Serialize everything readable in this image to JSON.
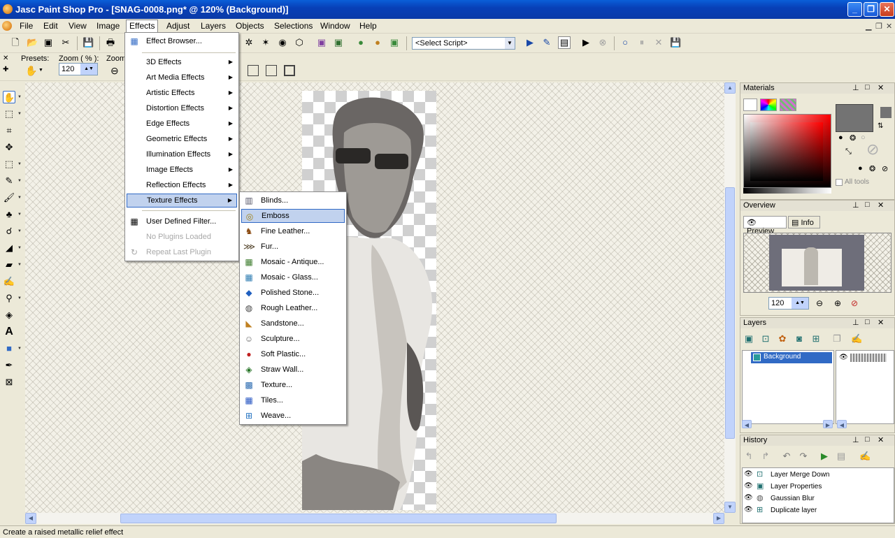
{
  "window": {
    "title": "Jasc Paint Shop Pro - [SNAG-0008.png* @ 120% (Background)]"
  },
  "menubar": {
    "items": [
      "File",
      "Edit",
      "View",
      "Image",
      "Effects",
      "Adjust",
      "Layers",
      "Objects",
      "Selections",
      "Window",
      "Help"
    ],
    "active": "Effects"
  },
  "toolbar": {
    "script_select": "<Select Script>"
  },
  "tool_options": {
    "presets_label": "Presets:",
    "zoom_label": "Zoom ( % ):",
    "zoom_value": "120",
    "zoom_label2": "Zoom"
  },
  "effects_menu": {
    "items": [
      {
        "label": "Effect Browser...",
        "icon": "effect-browser-icon"
      },
      {
        "label": "3D Effects",
        "submenu": true
      },
      {
        "label": "Art Media Effects",
        "submenu": true
      },
      {
        "label": "Artistic Effects",
        "submenu": true
      },
      {
        "label": "Distortion Effects",
        "submenu": true
      },
      {
        "label": "Edge Effects",
        "submenu": true
      },
      {
        "label": "Geometric Effects",
        "submenu": true
      },
      {
        "label": "Illumination Effects",
        "submenu": true
      },
      {
        "label": "Image Effects",
        "submenu": true
      },
      {
        "label": "Reflection Effects",
        "submenu": true
      },
      {
        "label": "Texture Effects",
        "submenu": true,
        "highlighted": true
      },
      {
        "label": "User Defined Filter...",
        "icon": "filter-grid-icon"
      },
      {
        "label": "No Plugins Loaded",
        "disabled": true
      },
      {
        "label": "Repeat Last Plugin",
        "disabled": true
      }
    ]
  },
  "texture_menu": {
    "items": [
      {
        "label": "Blinds...",
        "icon": "blinds-icon"
      },
      {
        "label": "Emboss",
        "icon": "emboss-icon",
        "highlighted": true
      },
      {
        "label": "Fine Leather...",
        "icon": "fine-leather-icon"
      },
      {
        "label": "Fur...",
        "icon": "fur-icon"
      },
      {
        "label": "Mosaic - Antique...",
        "icon": "mosaic-antique-icon"
      },
      {
        "label": "Mosaic - Glass...",
        "icon": "mosaic-glass-icon"
      },
      {
        "label": "Polished Stone...",
        "icon": "polished-stone-icon"
      },
      {
        "label": "Rough Leather...",
        "icon": "rough-leather-icon"
      },
      {
        "label": "Sandstone...",
        "icon": "sandstone-icon"
      },
      {
        "label": "Sculpture...",
        "icon": "sculpture-icon"
      },
      {
        "label": "Soft Plastic...",
        "icon": "soft-plastic-icon"
      },
      {
        "label": "Straw Wall...",
        "icon": "straw-wall-icon"
      },
      {
        "label": "Texture...",
        "icon": "texture-icon"
      },
      {
        "label": "Tiles...",
        "icon": "tiles-icon"
      },
      {
        "label": "Weave...",
        "icon": "weave-icon"
      }
    ]
  },
  "materials": {
    "title": "Materials",
    "all_tools": "All tools"
  },
  "overview": {
    "title": "Overview",
    "tab_preview": "Preview",
    "tab_info": "Info",
    "zoom_value": "120"
  },
  "layers": {
    "title": "Layers",
    "layer_name": "Background"
  },
  "history": {
    "title": "History",
    "items": [
      "Layer Merge Down",
      "Layer Properties",
      "Gaussian Blur",
      "Duplicate layer"
    ]
  },
  "statusbar": {
    "text": "Create a raised metallic relief effect"
  },
  "colors": {
    "title_bar": "#0a46c8",
    "highlight": "#316ac5",
    "face": "#ece9d8",
    "foreground_swatch": "#737373"
  }
}
